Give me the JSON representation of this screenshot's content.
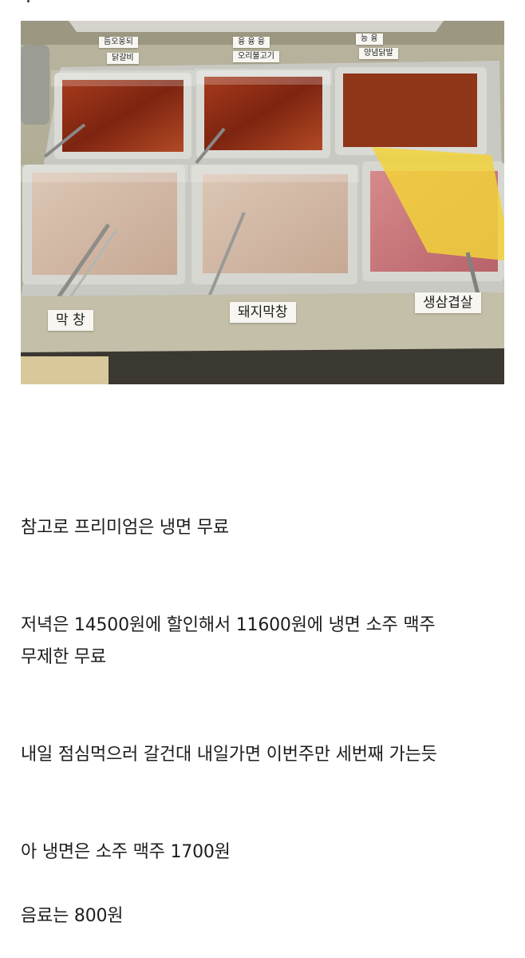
{
  "photo": {
    "labels_top": [
      "닭갈비",
      "오리불고기",
      "양념닭발"
    ],
    "labels_top_back": [
      "듬오웅되",
      "융 융 융",
      "능 융"
    ],
    "labels_bottom": [
      "막 창",
      "돼지막창",
      "생삼겹살"
    ]
  },
  "post": {
    "p1": "참고로 프리미엄은 냉면 무료",
    "p2a": "저녁은 14500원에 할인해서 11600원에 냉면 소주 맥주",
    "p2b": "무제한 무료",
    "p3": "내일 점심먹으러 갈건대 내일가면 이번주만 세번째 가는듯",
    "p4": "아 냉면은 소주 맥주 1700원",
    "p5": "음료는 800원"
  }
}
